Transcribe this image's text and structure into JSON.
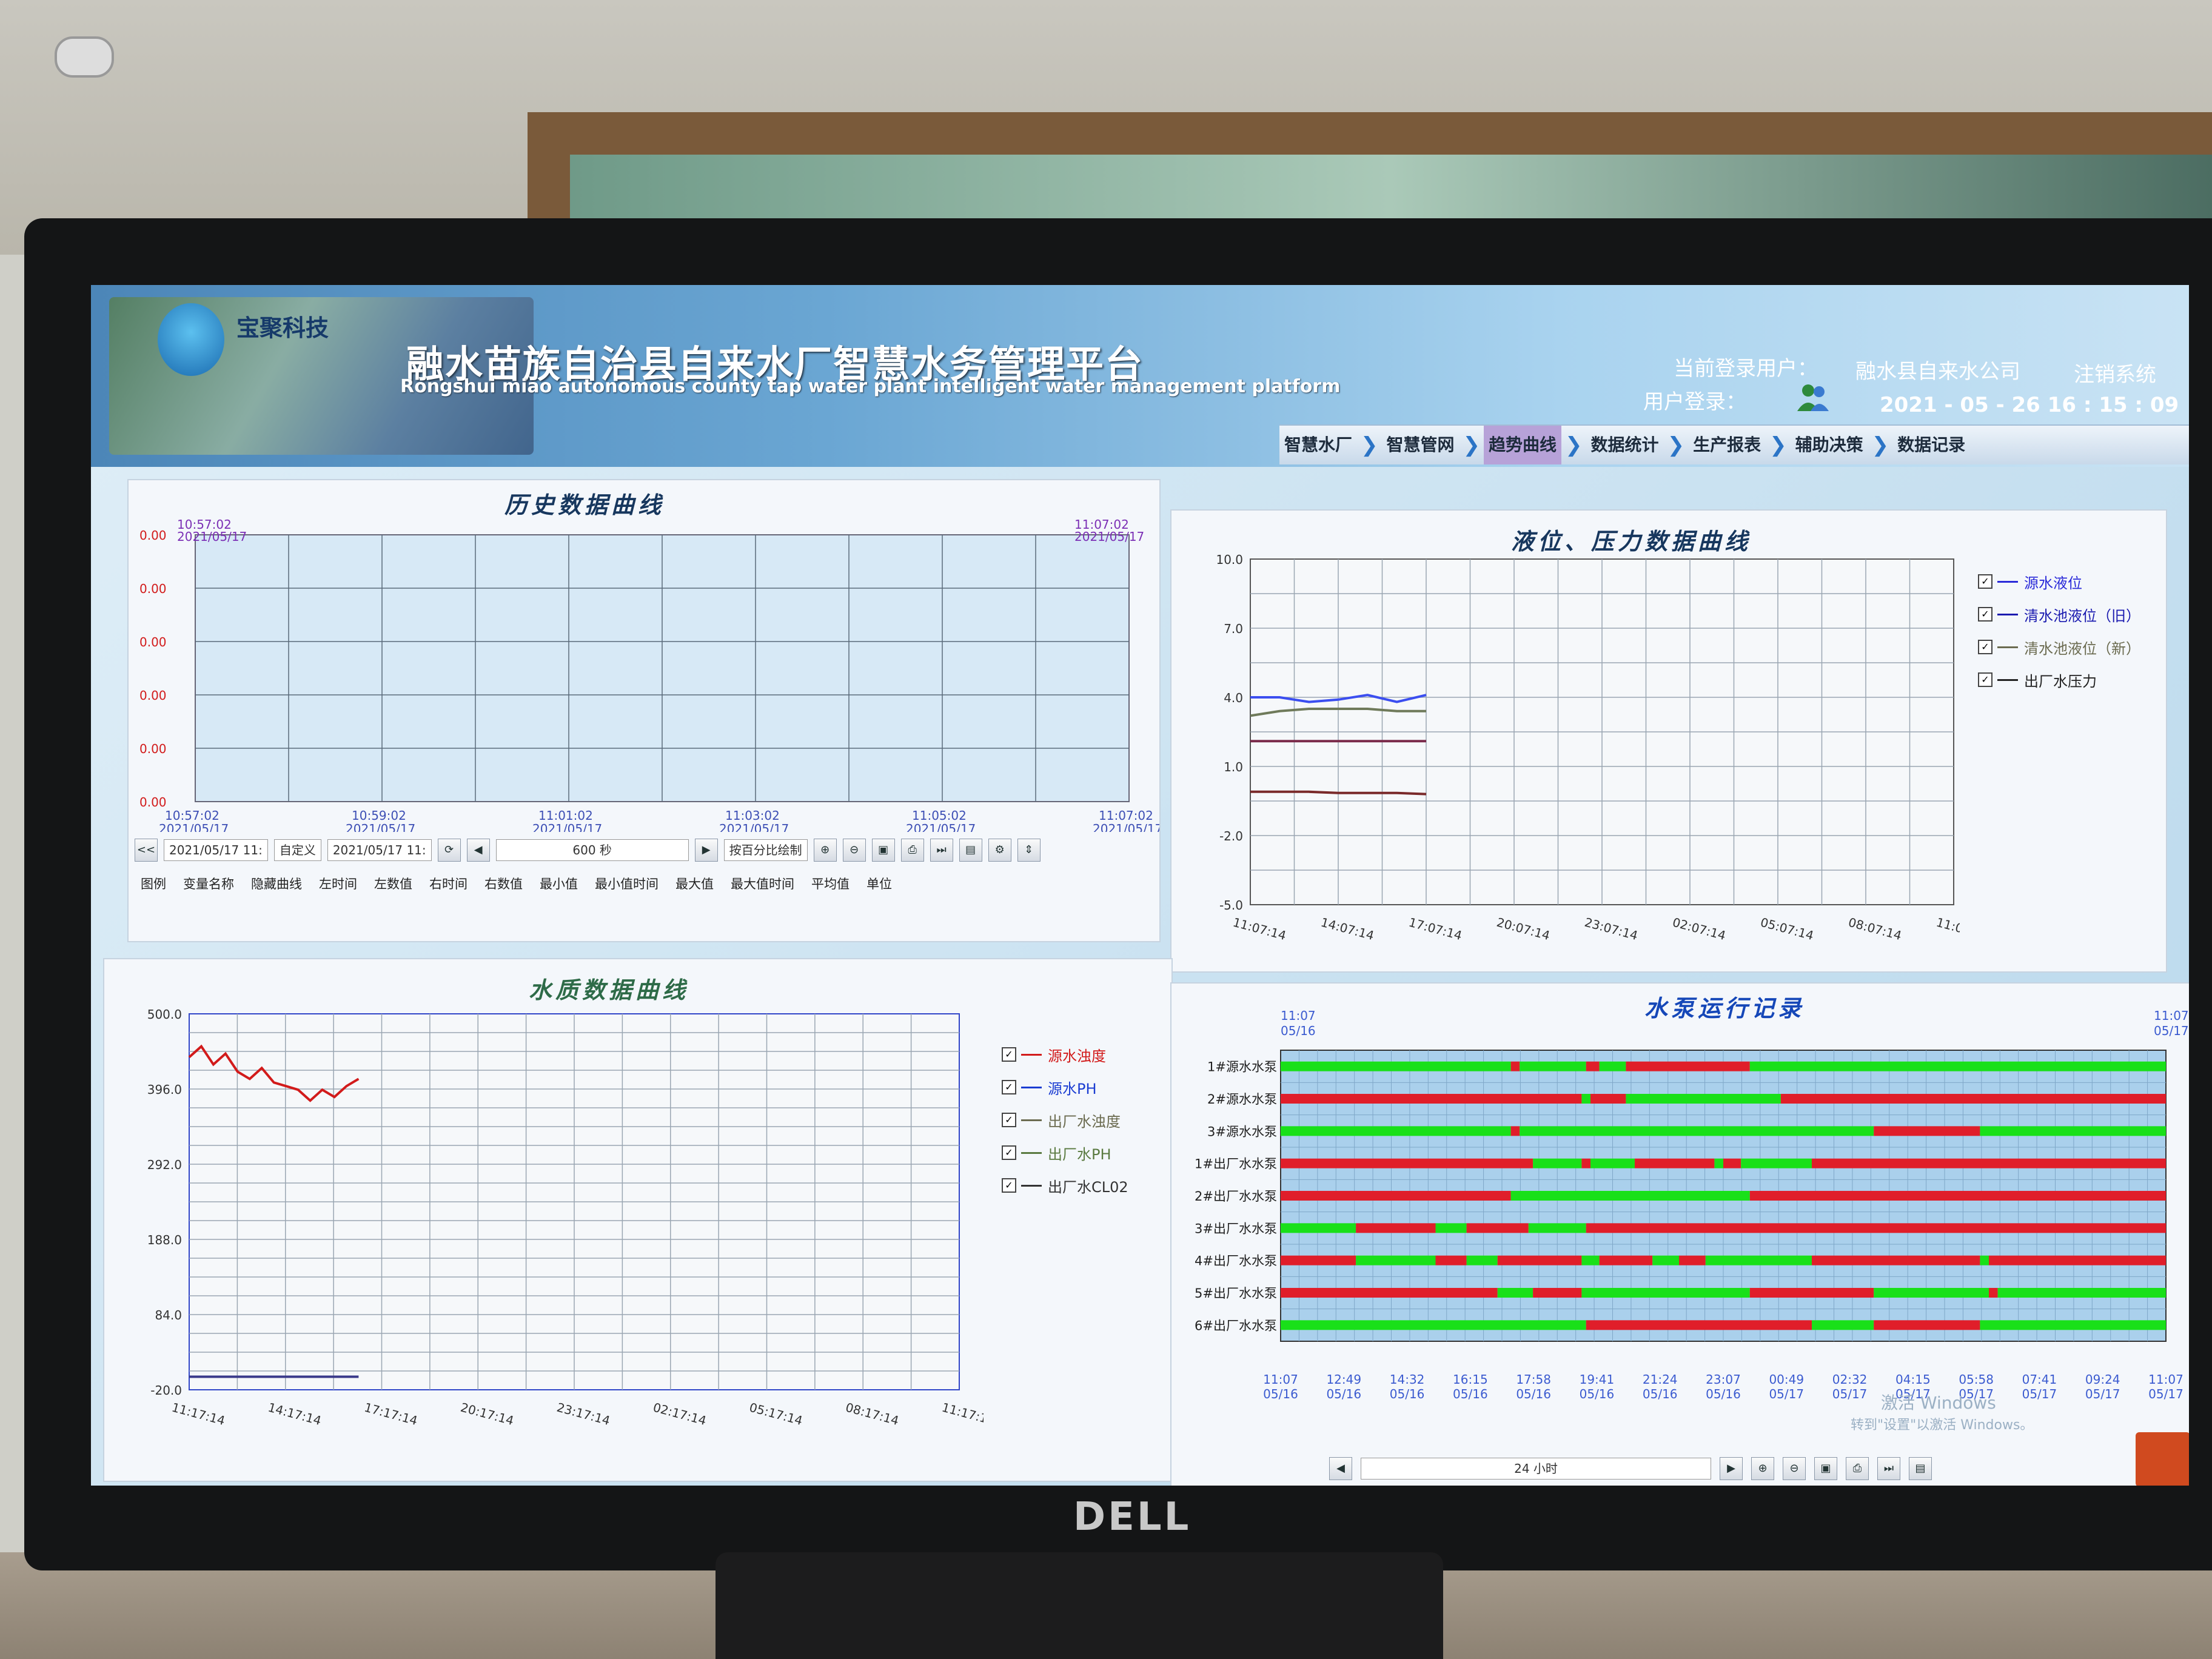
{
  "header": {
    "company": "宝聚科技",
    "title_cn": "融水苗族自治县自来水厂智慧水务管理平台",
    "title_en": "Rongshui miao autonomous county tap water plant intelligent water management platform",
    "current_user_label": "当前登录用户：",
    "current_user_value": "融水县自来水公司",
    "logout_label": "注销系统",
    "login_label": "用户登录：",
    "datetime": "2021 - 05 - 26   16 : 15 : 09"
  },
  "nav": {
    "items": [
      {
        "label": "智慧水厂"
      },
      {
        "label": "智慧管网"
      },
      {
        "label": "趋势曲线"
      },
      {
        "label": "数据统计"
      },
      {
        "label": "生产报表"
      },
      {
        "label": "辅助决策"
      },
      {
        "label": "数据记录"
      }
    ],
    "active_index": 2
  },
  "history": {
    "title": "历史数据曲线",
    "start_label": "10:57:02",
    "start_date": "2021/05/17",
    "end_label": "11:07:02",
    "end_date": "2021/05/17",
    "y_ticks": [
      "0.00",
      "0.00",
      "0.00",
      "0.00",
      "0.00",
      "0.00"
    ],
    "x_ticks": [
      {
        "t": "10:57:02",
        "d": "2021/05/17"
      },
      {
        "t": "10:59:02",
        "d": "2021/05/17"
      },
      {
        "t": "11:01:02",
        "d": "2021/05/17"
      },
      {
        "t": "11:03:02",
        "d": "2021/05/17"
      },
      {
        "t": "11:05:02",
        "d": "2021/05/17"
      },
      {
        "t": "11:07:02",
        "d": "2021/05/17"
      }
    ],
    "toolbar": {
      "start_value": "2021/05/17  11:",
      "mode_value": "自定义",
      "end_value": "2021/05/17  11:",
      "span_value": "600 秒",
      "draw_mode": "按百分比绘制"
    },
    "columns": [
      "图例",
      "变量名称",
      "隐藏曲线",
      "左时间",
      "左数值",
      "右时间",
      "右数值",
      "最小值",
      "最小值时间",
      "最大值",
      "最大值时间",
      "平均值",
      "单位"
    ]
  },
  "level": {
    "title": "液位、压力数据曲线",
    "y_ticks": [
      "10.0",
      "7.0",
      "4.0",
      "1.0",
      "-2.0",
      "-5.0"
    ],
    "x_ticks": [
      "11:07:14",
      "14:07:14",
      "17:07:14",
      "20:07:14",
      "23:07:14",
      "02:07:14",
      "05:07:14",
      "08:07:14",
      "11:07:14"
    ],
    "legend": [
      {
        "label": "源水液位",
        "color": "#2b2bd9"
      },
      {
        "label": "清水池液位（旧）",
        "color": "#1b1bb0"
      },
      {
        "label": "清水池液位（新）",
        "color": "#6b6b50"
      },
      {
        "label": "出厂水压力",
        "color": "#222222"
      }
    ],
    "chart_data": {
      "type": "line",
      "ylim": [
        -5,
        10
      ],
      "x": [
        "11:07:14",
        "12:07:14",
        "13:07:14",
        "14:07:14",
        "15:07:14",
        "16:07:14",
        "17:07:14"
      ],
      "series": [
        {
          "name": "源水液位",
          "color": "#3b4ef0",
          "values": [
            4.0,
            4.0,
            3.8,
            3.9,
            4.1,
            3.8,
            4.1
          ]
        },
        {
          "name": "清水池液位（新）",
          "color": "#6f7a5a",
          "values": [
            3.2,
            3.4,
            3.5,
            3.5,
            3.5,
            3.4,
            3.4
          ]
        },
        {
          "name": "清水池液位（旧）",
          "color": "#7a2a4a",
          "values": [
            2.1,
            2.1,
            2.1,
            2.1,
            2.1,
            2.1,
            2.1
          ]
        },
        {
          "name": "出厂水压力",
          "color": "#7a2a2a",
          "values": [
            -0.1,
            -0.1,
            -0.1,
            -0.15,
            -0.15,
            -0.15,
            -0.2
          ]
        }
      ]
    }
  },
  "water": {
    "title": "水质数据曲线",
    "y_ticks": [
      "500.0",
      "396.0",
      "292.0",
      "188.0",
      "84.0",
      "-20.0"
    ],
    "x_ticks": [
      "11:17:14",
      "14:17:14",
      "17:17:14",
      "20:17:14",
      "23:17:14",
      "02:17:14",
      "05:17:14",
      "08:17:14",
      "11:17:14"
    ],
    "legend": [
      {
        "label": "源水浊度",
        "color": "#d21b1b"
      },
      {
        "label": "源水PH",
        "color": "#1b3dd2"
      },
      {
        "label": "出厂水浊度",
        "color": "#6b6b50"
      },
      {
        "label": "出厂水PH",
        "color": "#5a7a40"
      },
      {
        "label": "出厂水CL02",
        "color": "#333333"
      }
    ],
    "chart_data": {
      "type": "line",
      "ylim": [
        -20,
        500
      ],
      "x": [
        "11:17",
        "11:47",
        "12:17",
        "12:47",
        "13:17",
        "13:47",
        "14:17",
        "14:47",
        "15:17",
        "15:47",
        "16:17",
        "16:47",
        "17:17",
        "17:47",
        "18:17"
      ],
      "series": [
        {
          "name": "源水浊度",
          "color": "#d21b1b",
          "values": [
            440,
            455,
            430,
            445,
            420,
            410,
            425,
            405,
            400,
            395,
            380,
            395,
            385,
            400,
            410
          ]
        },
        {
          "name": "出厂水浊度",
          "color": "#3a3a8a",
          "values": [
            -2,
            -2,
            -2,
            -2,
            -2,
            -2,
            -2,
            -2,
            -2,
            -2,
            -2,
            -2,
            -2,
            -2,
            -2
          ]
        }
      ]
    }
  },
  "pump": {
    "title": "水泵运行记录",
    "start_time": "11:07",
    "start_date": "05/16",
    "end_time": "11:07",
    "end_date": "05/17",
    "rows": [
      {
        "label": "1#源水水泵",
        "segments": [
          [
            "g",
            0,
            0.26
          ],
          [
            "r",
            0.26,
            0.27
          ],
          [
            "g",
            0.27,
            0.345
          ],
          [
            "r",
            0.345,
            0.36
          ],
          [
            "g",
            0.36,
            0.39
          ],
          [
            "r",
            0.39,
            0.53
          ],
          [
            "g",
            0.53,
            1.0
          ]
        ]
      },
      {
        "label": "2#源水水泵",
        "segments": [
          [
            "r",
            0,
            0.34
          ],
          [
            "g",
            0.34,
            0.35
          ],
          [
            "r",
            0.35,
            0.39
          ],
          [
            "g",
            0.39,
            0.565
          ],
          [
            "r",
            0.565,
            1.0
          ]
        ]
      },
      {
        "label": "3#源水水泵",
        "segments": [
          [
            "g",
            0,
            0.26
          ],
          [
            "r",
            0.26,
            0.27
          ],
          [
            "g",
            0.27,
            0.67
          ],
          [
            "r",
            0.67,
            0.79
          ],
          [
            "g",
            0.79,
            1.0
          ]
        ]
      },
      {
        "label": "1#出厂水水泵",
        "segments": [
          [
            "r",
            0,
            0.285
          ],
          [
            "g",
            0.285,
            0.34
          ],
          [
            "r",
            0.34,
            0.35
          ],
          [
            "g",
            0.35,
            0.4
          ],
          [
            "r",
            0.4,
            0.49
          ],
          [
            "g",
            0.49,
            0.5
          ],
          [
            "r",
            0.5,
            0.52
          ],
          [
            "g",
            0.52,
            0.6
          ],
          [
            "r",
            0.6,
            1.0
          ]
        ]
      },
      {
        "label": "2#出厂水水泵",
        "segments": [
          [
            "r",
            0,
            0.26
          ],
          [
            "g",
            0.26,
            0.53
          ],
          [
            "r",
            0.53,
            1.0
          ]
        ]
      },
      {
        "label": "3#出厂水水泵",
        "segments": [
          [
            "g",
            0,
            0.085
          ],
          [
            "r",
            0.085,
            0.175
          ],
          [
            "g",
            0.175,
            0.21
          ],
          [
            "r",
            0.21,
            0.28
          ],
          [
            "g",
            0.28,
            0.345
          ],
          [
            "r",
            0.345,
            1.0
          ]
        ]
      },
      {
        "label": "4#出厂水水泵",
        "segments": [
          [
            "r",
            0,
            0.085
          ],
          [
            "g",
            0.085,
            0.175
          ],
          [
            "r",
            0.175,
            0.21
          ],
          [
            "g",
            0.21,
            0.245
          ],
          [
            "r",
            0.245,
            0.34
          ],
          [
            "g",
            0.34,
            0.36
          ],
          [
            "r",
            0.36,
            0.42
          ],
          [
            "g",
            0.42,
            0.45
          ],
          [
            "r",
            0.45,
            0.48
          ],
          [
            "g",
            0.48,
            0.6
          ],
          [
            "r",
            0.6,
            0.79
          ],
          [
            "g",
            0.79,
            0.8
          ],
          [
            "r",
            0.8,
            1.0
          ]
        ]
      },
      {
        "label": "5#出厂水水泵",
        "segments": [
          [
            "r",
            0,
            0.245
          ],
          [
            "g",
            0.245,
            0.285
          ],
          [
            "r",
            0.285,
            0.34
          ],
          [
            "g",
            0.34,
            0.53
          ],
          [
            "r",
            0.53,
            0.67
          ],
          [
            "g",
            0.67,
            0.8
          ],
          [
            "r",
            0.8,
            0.81
          ],
          [
            "g",
            0.81,
            1.0
          ]
        ]
      },
      {
        "label": "6#出厂水水泵",
        "segments": [
          [
            "g",
            0,
            0.345
          ],
          [
            "r",
            0.345,
            0.6
          ],
          [
            "g",
            0.6,
            0.67
          ],
          [
            "r",
            0.67,
            0.79
          ],
          [
            "g",
            0.79,
            1.0
          ]
        ]
      }
    ],
    "x_ticks": [
      {
        "t": "11:07",
        "d": "05/16"
      },
      {
        "t": "12:49",
        "d": "05/16"
      },
      {
        "t": "14:32",
        "d": "05/16"
      },
      {
        "t": "16:15",
        "d": "05/16"
      },
      {
        "t": "17:58",
        "d": "05/16"
      },
      {
        "t": "19:41",
        "d": "05/16"
      },
      {
        "t": "21:24",
        "d": "05/16"
      },
      {
        "t": "23:07",
        "d": "05/16"
      },
      {
        "t": "00:49",
        "d": "05/17"
      },
      {
        "t": "02:32",
        "d": "05/17"
      },
      {
        "t": "04:15",
        "d": "05/17"
      },
      {
        "t": "05:58",
        "d": "05/17"
      },
      {
        "t": "07:41",
        "d": "05/17"
      },
      {
        "t": "09:24",
        "d": "05/17"
      },
      {
        "t": "11:07",
        "d": "05/17"
      }
    ],
    "span_value": "24 小时",
    "colors": {
      "on": "#19e019",
      "off": "#e01e2a"
    }
  },
  "watermark": {
    "line1": "激活 Windows",
    "line2": "转到\"设置\"以激活 Windows。"
  },
  "monitor_brand": "DELL"
}
